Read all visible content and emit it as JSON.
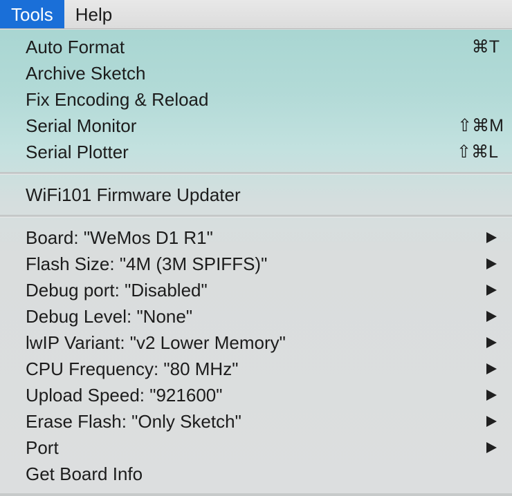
{
  "menubar": {
    "items": [
      {
        "label": "Tools"
      },
      {
        "label": "Help"
      }
    ]
  },
  "menu": {
    "group1": [
      {
        "label": "Auto Format",
        "shortcut": "⌘T"
      },
      {
        "label": "Archive Sketch",
        "shortcut": ""
      },
      {
        "label": "Fix Encoding & Reload",
        "shortcut": ""
      },
      {
        "label": "Serial Monitor",
        "shortcut": "⇧⌘M"
      },
      {
        "label": "Serial Plotter",
        "shortcut": "⇧⌘L"
      }
    ],
    "group2": [
      {
        "label": "WiFi101 Firmware Updater"
      }
    ],
    "group3": [
      {
        "label": "Board: \"WeMos D1 R1\"",
        "submenu": true
      },
      {
        "label": "Flash Size: \"4M (3M SPIFFS)\"",
        "submenu": true
      },
      {
        "label": "Debug port: \"Disabled\"",
        "submenu": true
      },
      {
        "label": "Debug Level: \"None\"",
        "submenu": true
      },
      {
        "label": "lwIP Variant: \"v2 Lower Memory\"",
        "submenu": true
      },
      {
        "label": "CPU Frequency: \"80 MHz\"",
        "submenu": true
      },
      {
        "label": "Upload Speed: \"921600\"",
        "submenu": true
      },
      {
        "label": "Erase Flash: \"Only Sketch\"",
        "submenu": true
      },
      {
        "label": "Port",
        "submenu": true
      },
      {
        "label": "Get Board Info",
        "submenu": false
      }
    ]
  }
}
